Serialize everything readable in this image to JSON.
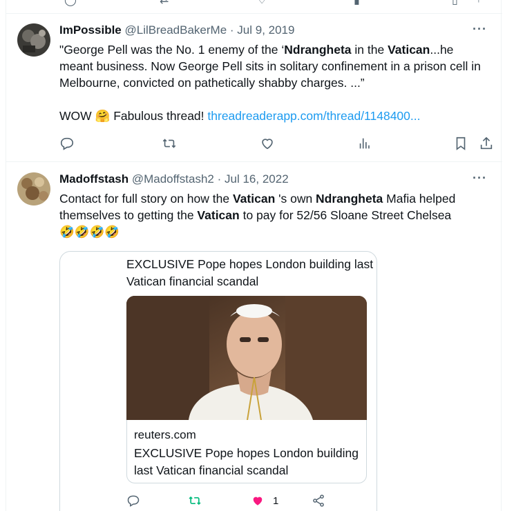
{
  "tweets": [
    {
      "name": "ImPossible",
      "handle": "@LilBreadBakerMe",
      "separator": "·",
      "date": "Jul 9, 2019",
      "text_parts": [
        "\"George Pell was the No. 1 enemy of the ‘",
        "Ndrangheta",
        " in the ",
        "Vatican",
        "...he meant business. Now George Pell sits in solitary confinement in a prison cell in Melbourne, convicted on pathetically shabby charges. ...”"
      ],
      "line2_prefix": "WOW",
      "line2_emoji": "🤗",
      "line2_text": " Fabulous thread! ",
      "link": "threadreaderapp.com/thread/1148400..."
    },
    {
      "name": "Madoffstash",
      "handle": "@Madoffstash2",
      "separator": "·",
      "date": "Jul 16, 2022",
      "text_parts": [
        "Contact for full story on how the ",
        "Vatican",
        " 's own ",
        "Ndrangheta",
        " Mafia helped themselves to getting the ",
        "Vatican",
        " to pay for 52/56 Sloane Street Chelsea"
      ],
      "emojis": "🤣🤣🤣🤣",
      "card": {
        "quote_title": "EXCLUSIVE Pope hopes London building last Vatican financial scandal",
        "domain": "reuters.com",
        "link_title": "EXCLUSIVE Pope hopes London building last Vatican financial scandal",
        "like_count": "1"
      }
    }
  ],
  "more_label": "···",
  "colors": {
    "accent": "#1d9bf0",
    "muted": "#536471",
    "retweet_green": "#00ba7c",
    "like_pink": "#f91880",
    "border": "#eff3f4"
  },
  "icons": [
    "reply-icon",
    "retweet-icon",
    "like-icon",
    "views-icon",
    "bookmark-icon",
    "share-icon",
    "more-icon"
  ]
}
